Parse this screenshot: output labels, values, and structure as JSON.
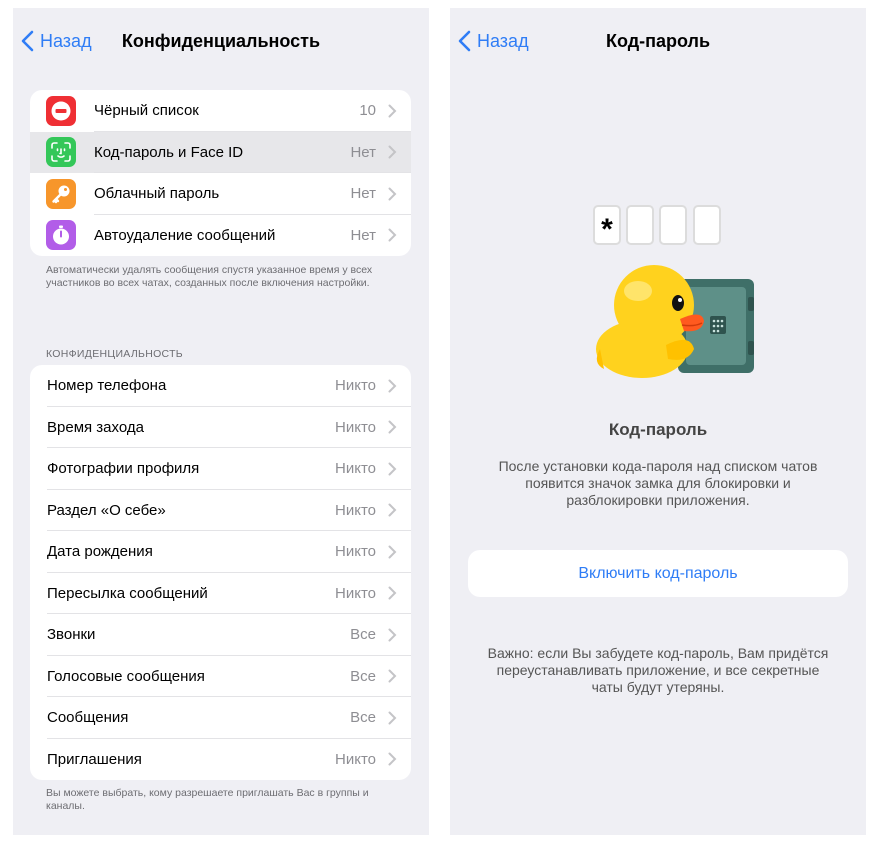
{
  "left": {
    "back_label": "Назад",
    "title": "Конфиденциальность",
    "security_items": [
      {
        "label": "Чёрный список",
        "value": "10",
        "icon": "blocked-icon",
        "color": "#ef2f34"
      },
      {
        "label": "Код-пароль и Face ID",
        "value": "Нет",
        "icon": "face-id-icon",
        "color": "#34c759"
      },
      {
        "label": "Облачный пароль",
        "value": "Нет",
        "icon": "key-icon",
        "color": "#f7962b"
      },
      {
        "label": "Автоудаление сообщений",
        "value": "Нет",
        "icon": "timer-icon",
        "color": "#b25de8"
      }
    ],
    "security_footer": "Автоматически удалять сообщения спустя указанное время у всех участников во всех чатах, созданных после включения настройки.",
    "privacy_header": "КОНФИДЕНЦИАЛЬНОСТЬ",
    "privacy_items": [
      {
        "label": "Номер телефона",
        "value": "Никто"
      },
      {
        "label": "Время захода",
        "value": "Никто"
      },
      {
        "label": "Фотографии профиля",
        "value": "Никто"
      },
      {
        "label": "Раздел «О себе»",
        "value": "Никто"
      },
      {
        "label": "Дата рождения",
        "value": "Никто"
      },
      {
        "label": "Пересылка сообщений",
        "value": "Никто"
      },
      {
        "label": "Звонки",
        "value": "Все"
      },
      {
        "label": "Голосовые сообщения",
        "value": "Все"
      },
      {
        "label": "Сообщения",
        "value": "Все"
      },
      {
        "label": "Приглашения",
        "value": "Никто"
      }
    ],
    "privacy_footer": "Вы можете выбрать, кому разрешаете приглашать Вас в группы и каналы."
  },
  "right": {
    "back_label": "Назад",
    "title": "Код-пароль",
    "passcode_char": "*",
    "heading": "Код-пароль",
    "description": "После установки кода-пароля над списком чатов появится значок замка для блокировки и разблокировки приложения.",
    "button_label": "Включить код-пароль",
    "note": "Важно: если Вы забудете код-пароль, Вам придётся переустанавливать приложение, и все секретные чаты будут утеряны."
  },
  "colors": {
    "accent": "#2f7df6",
    "background": "#efeff4"
  }
}
